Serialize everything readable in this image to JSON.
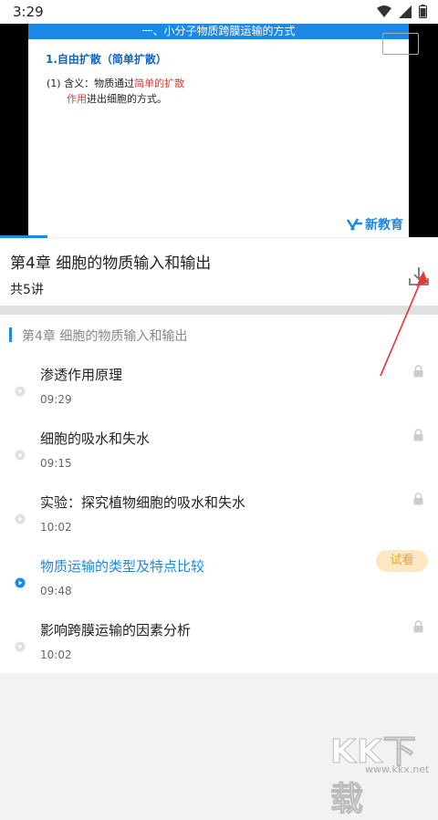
{
  "status": {
    "time": "3:29"
  },
  "video": {
    "slide_title": "一、小分子物质跨膜运输的方式",
    "slide_heading": "1.自由扩散（简单扩散）",
    "line1_prefix": "(1)  含义：物质通过",
    "line1_red": "简单的扩散",
    "line2_red": "作用",
    "line2_rest": "进出细胞的方式。",
    "logo_text": "新教育"
  },
  "course": {
    "title": "第4章 细胞的物质输入和输出",
    "count": "共5讲"
  },
  "chapter": {
    "title": "第4章 细胞的物质输入和输出"
  },
  "lessons": [
    {
      "name": "渗透作用原理",
      "duration": "09:29"
    },
    {
      "name": "细胞的吸水和失水",
      "duration": "09:15"
    },
    {
      "name": "实验：探究植物细胞的吸水和失水",
      "duration": "10:02"
    },
    {
      "name": "物质运输的类型及特点比较",
      "duration": "09:48",
      "badge": "试看"
    },
    {
      "name": "影响跨膜运输的因素分析",
      "duration": "10:02"
    }
  ],
  "watermark": {
    "main": "KK下载",
    "sub": "www.kkx.net"
  },
  "colors": {
    "accent": "#1e88e5",
    "badge_bg": "#fde8c4",
    "badge_text": "#e8a33a",
    "arrow": "#e53935"
  }
}
